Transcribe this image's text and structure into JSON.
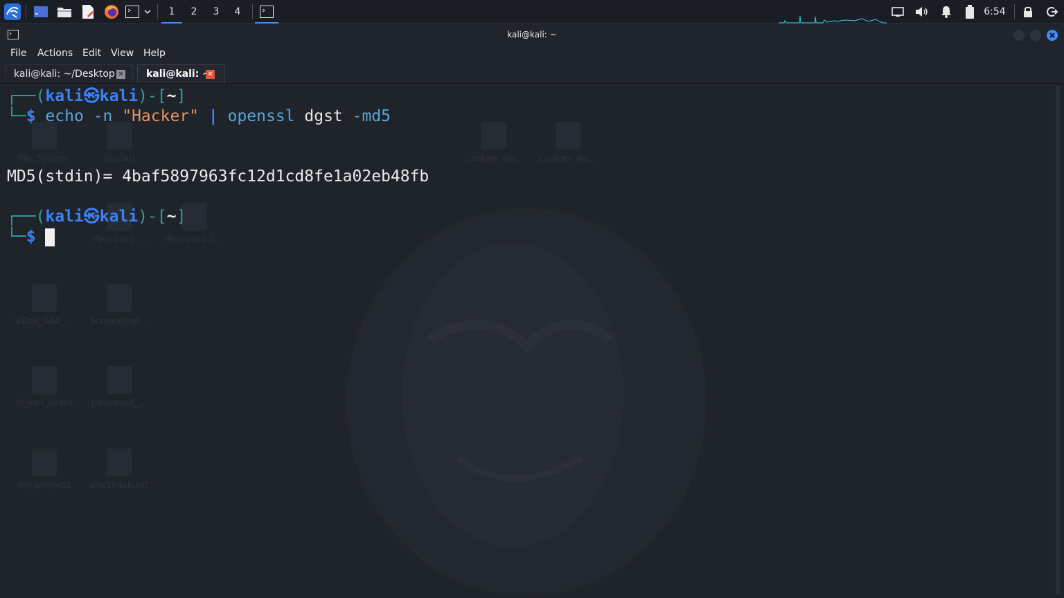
{
  "taskbar": {
    "workspaces": [
      "1",
      "2",
      "3",
      "4"
    ],
    "active_workspace": "1",
    "clock": "6:54"
  },
  "window": {
    "title": "kali@kali: ~"
  },
  "menu": [
    "File",
    "Actions",
    "Edit",
    "View",
    "Help"
  ],
  "tabs": [
    {
      "label": "kali@kali: ~/Desktop",
      "active": false
    },
    {
      "label": "kali@kali: ~",
      "active": true
    }
  ],
  "terminal": {
    "prompt_user": "kali",
    "prompt_host": "kali",
    "prompt_dir": "~",
    "prompt_symbol": "$",
    "command": {
      "cmd1": "echo",
      "flag1": "-n",
      "arg": "\"Hacker\"",
      "pipe": "|",
      "cmd2": "openssl",
      "sub": "dgst",
      "flag2": "-md5"
    },
    "output": "MD5(stdin)= 4baf5897963fc12d1cd8fe1a02eb48fb"
  },
  "desktop_icons": [
    "File System",
    "testlab",
    "Custom wo...",
    "Custom wo...",
    "Password-...",
    "Password c...",
    "VBox_GAs_...",
    "Screenshot...",
    "sf_kali_share",
    "password_...",
    "my projects",
    "sha1hash.txt"
  ],
  "colors": {
    "accent": "#3b82f6",
    "prompt_frame": "#2f9fa0",
    "string": "#e69561",
    "command": "#5aa5d8",
    "close_red": "#e0533c"
  }
}
